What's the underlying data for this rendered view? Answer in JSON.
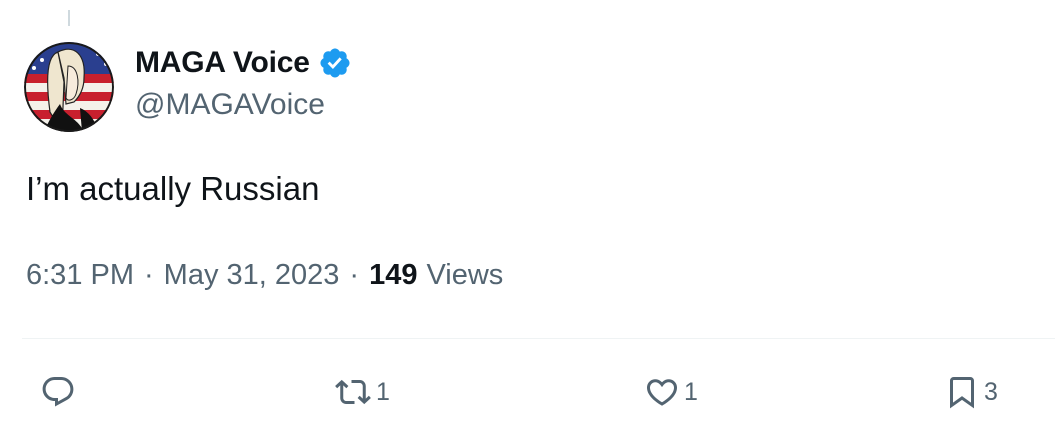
{
  "author": {
    "display_name": "MAGA Voice",
    "handle": "@MAGAVoice",
    "verified": true
  },
  "tweet": {
    "text": "I’m actually Russian"
  },
  "meta": {
    "time": "6:31 PM",
    "separator": "·",
    "date": "May 31, 2023",
    "views_count": "149",
    "views_label": "Views"
  },
  "actions": {
    "reply": {
      "icon": "reply-icon"
    },
    "retweet": {
      "icon": "retweet-icon",
      "count": "1"
    },
    "like": {
      "icon": "heart-icon",
      "count": "1"
    },
    "bookmark": {
      "icon": "bookmark-icon",
      "count": "3"
    }
  },
  "colors": {
    "text": "#0f1419",
    "secondary": "#536471",
    "verified_blue": "#1d9bf0",
    "divider": "#eff3f4"
  }
}
